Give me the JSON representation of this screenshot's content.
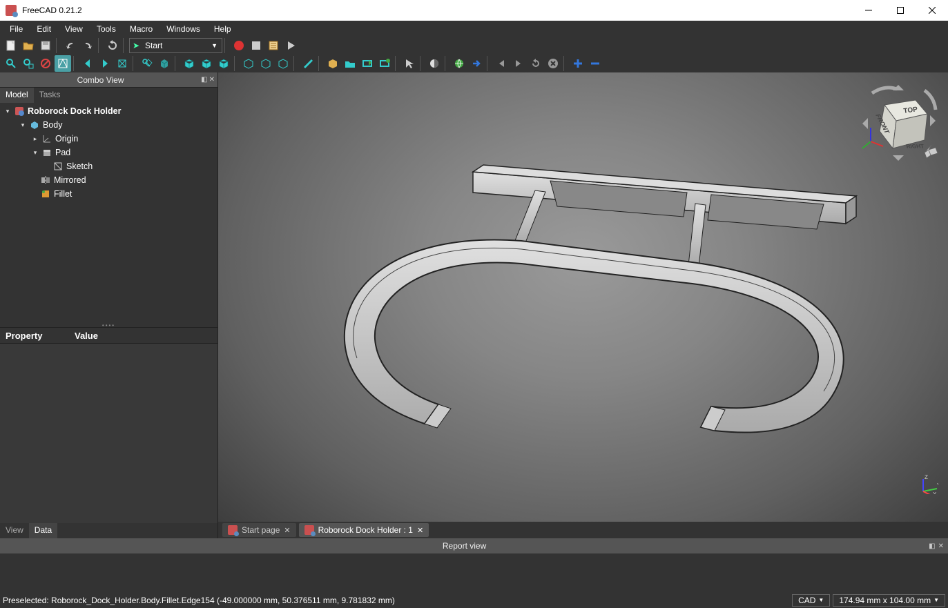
{
  "window": {
    "title": "FreeCAD 0.21.2"
  },
  "menubar": [
    "File",
    "Edit",
    "View",
    "Tools",
    "Macro",
    "Windows",
    "Help"
  ],
  "workbench_dropdown": "Start",
  "combo_view": {
    "title": "Combo View",
    "tabs": [
      "Model",
      "Tasks"
    ],
    "active_tab": 0,
    "tree": [
      {
        "indent": 0,
        "expanded": true,
        "icon": "doc",
        "label": "Roborock Dock Holder",
        "bold": true
      },
      {
        "indent": 1,
        "expanded": true,
        "icon": "body",
        "label": "Body"
      },
      {
        "indent": 2,
        "expanded": false,
        "icon": "origin",
        "label": "Origin",
        "toggle": "right"
      },
      {
        "indent": 2,
        "expanded": true,
        "icon": "pad",
        "label": "Pad"
      },
      {
        "indent": 3,
        "expanded": null,
        "icon": "sketch",
        "label": "Sketch"
      },
      {
        "indent": 2,
        "expanded": null,
        "icon": "mirror",
        "label": "Mirrored"
      },
      {
        "indent": 2,
        "expanded": null,
        "icon": "fillet",
        "label": "Fillet"
      }
    ],
    "property_headers": [
      "Property",
      "Value"
    ],
    "bottom_tabs": [
      "View",
      "Data"
    ],
    "bottom_active": 1
  },
  "doc_tabs": [
    {
      "label": "Start page",
      "active": false
    },
    {
      "label": "Roborock Dock Holder : 1",
      "active": true
    }
  ],
  "report_view": {
    "title": "Report view"
  },
  "statusbar": {
    "message": "Preselected: Roborock_Dock_Holder.Body.Fillet.Edge154 (-49.000000 mm, 50.376511 mm, 9.781832 mm)",
    "mode": "CAD",
    "dims": "174.94 mm x 104.00 mm"
  },
  "navcube": {
    "faces": {
      "top": "TOP",
      "front": "FRONT",
      "right": "RIGHT"
    }
  }
}
